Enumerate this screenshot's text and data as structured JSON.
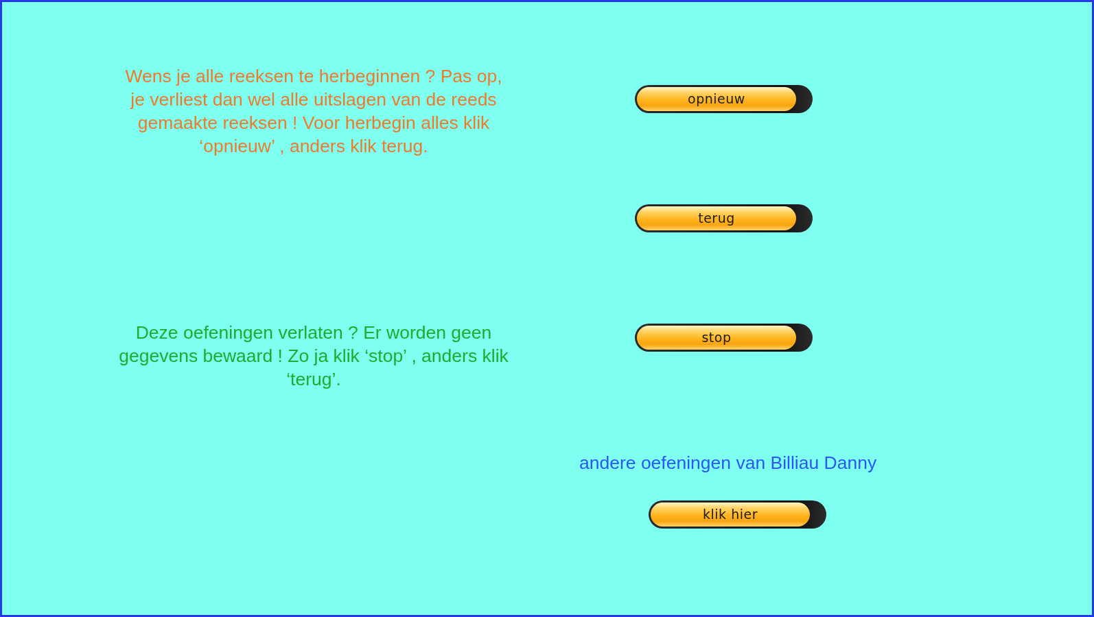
{
  "restart_notice": "Wens je alle reeksen te herbeginnen ? Pas op, je verliest dan wel alle uitslagen van de reeds gemaakte reeksen ! Voor herbegin alles klik ‘opnieuw’ , anders klik terug.",
  "restart_button": "opnieuw",
  "back_button": "terug",
  "exit_notice": "Deze oefeningen verlaten ? Er worden geen gegevens bewaard ! Zo ja klik ‘stop’ , anders klik ‘terug’.",
  "stop_button": "stop",
  "more_exercises": {
    "text": "andere oefeningen van Billiau Danny",
    "button": "klik hier"
  }
}
